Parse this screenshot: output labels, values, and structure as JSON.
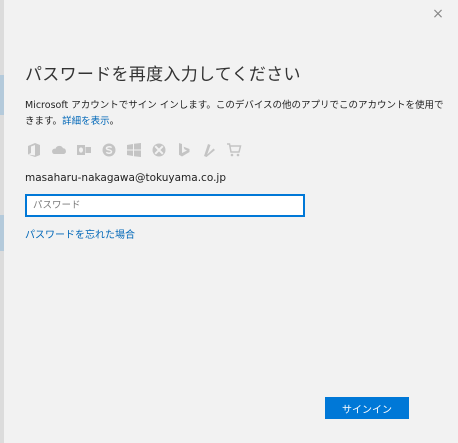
{
  "dialog": {
    "close_glyph": "×",
    "heading": "パスワードを再度入力してください",
    "description": "Microsoft アカウントでサイン インします。このデバイスの他のアプリでこのアカウントを使用できます。",
    "details_link": "詳細を表示",
    "details_suffix": "。",
    "account_email": "masaharu-nakagawa@tokuyama.co.jp",
    "password_placeholder": "パスワード",
    "password_value": "",
    "forgot_password_link": "パスワードを忘れた場合",
    "signin_button": "サインイン"
  },
  "service_icons": [
    "office-icon",
    "onedrive-icon",
    "outlook-icon",
    "skype-icon",
    "windows-icon",
    "xbox-icon",
    "bing-icon",
    "msn-icon",
    "store-icon"
  ],
  "colors": {
    "background": "#f2f2f2",
    "accent": "#0078d7",
    "link": "#0067b8",
    "icon_gray": "#c4c4c4"
  }
}
